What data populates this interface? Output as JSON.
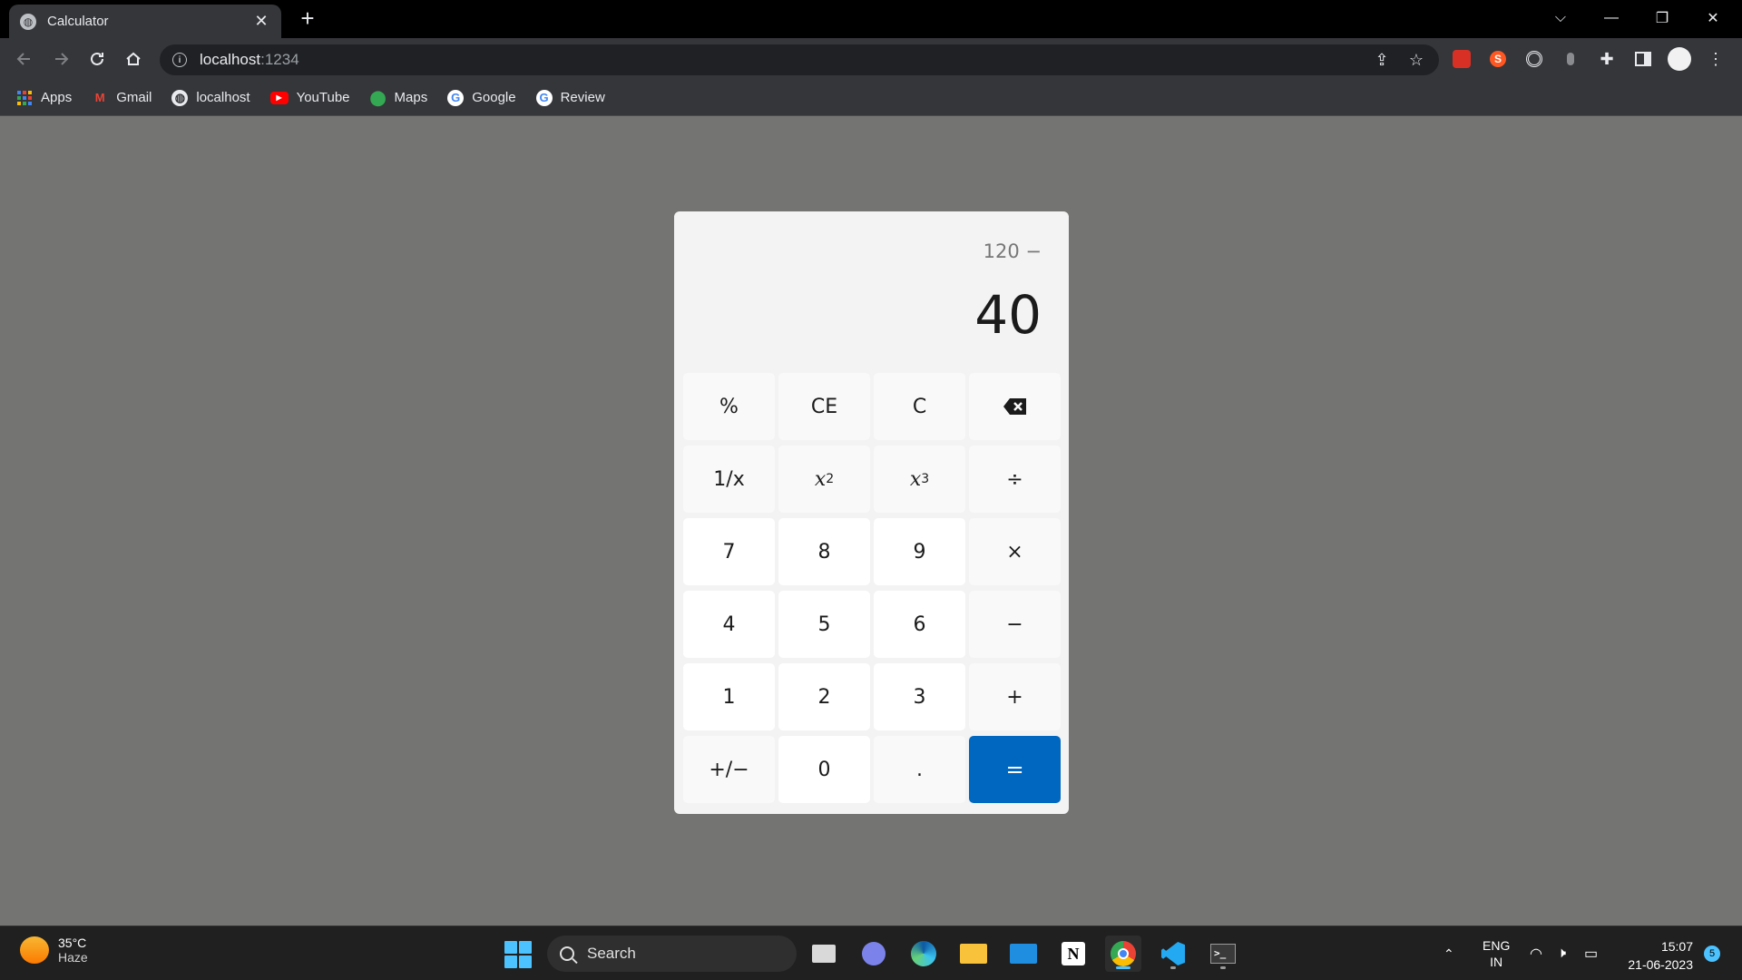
{
  "browser": {
    "tab_title": "Calculator",
    "tab_close": "✕",
    "new_tab": "+",
    "url_host": "localhost",
    "url_port": ":1234",
    "window_controls": {
      "dropdown": "⌵",
      "minimize": "—",
      "restore": "❐",
      "close": "✕"
    }
  },
  "bookmarks": [
    {
      "label": "Apps",
      "icon": "apps-grid-icon"
    },
    {
      "label": "Gmail",
      "icon": "gmail-icon"
    },
    {
      "label": "localhost",
      "icon": "globe-icon"
    },
    {
      "label": "YouTube",
      "icon": "youtube-icon"
    },
    {
      "label": "Maps",
      "icon": "maps-pin-icon"
    },
    {
      "label": "Google",
      "icon": "google-icon"
    },
    {
      "label": "Review",
      "icon": "google-icon"
    }
  ],
  "calculator": {
    "expression": "120 −",
    "result": "40",
    "keys": [
      {
        "label": "%",
        "kind": "op"
      },
      {
        "label": "CE",
        "kind": "op"
      },
      {
        "label": "C",
        "kind": "op"
      },
      {
        "label": "⌫",
        "kind": "op",
        "icon": "backspace-icon"
      },
      {
        "label": "1/x",
        "kind": "op"
      },
      {
        "label": "x²",
        "kind": "op",
        "base": "x",
        "exp": "2"
      },
      {
        "label": "x³",
        "kind": "op",
        "base": "x",
        "exp": "3"
      },
      {
        "label": "÷",
        "kind": "op"
      },
      {
        "label": "7",
        "kind": "num"
      },
      {
        "label": "8",
        "kind": "num"
      },
      {
        "label": "9",
        "kind": "num"
      },
      {
        "label": "×",
        "kind": "op"
      },
      {
        "label": "4",
        "kind": "num"
      },
      {
        "label": "5",
        "kind": "num"
      },
      {
        "label": "6",
        "kind": "num"
      },
      {
        "label": "−",
        "kind": "op"
      },
      {
        "label": "1",
        "kind": "num"
      },
      {
        "label": "2",
        "kind": "num"
      },
      {
        "label": "3",
        "kind": "num"
      },
      {
        "label": "+",
        "kind": "op"
      },
      {
        "label": "+/−",
        "kind": "op"
      },
      {
        "label": "0",
        "kind": "num"
      },
      {
        "label": ".",
        "kind": "op"
      },
      {
        "label": "=",
        "kind": "eq"
      }
    ],
    "colors": {
      "accent": "#0067c0",
      "panel": "#f3f3f3",
      "num_key": "#ffffff",
      "op_key": "#f9f9f9"
    }
  },
  "taskbar": {
    "weather_temp": "35°C",
    "weather_desc": "Haze",
    "search_label": "Search",
    "language_1": "ENG",
    "language_2": "IN",
    "time": "15:07",
    "date": "21-06-2023",
    "notification_count": "5"
  }
}
